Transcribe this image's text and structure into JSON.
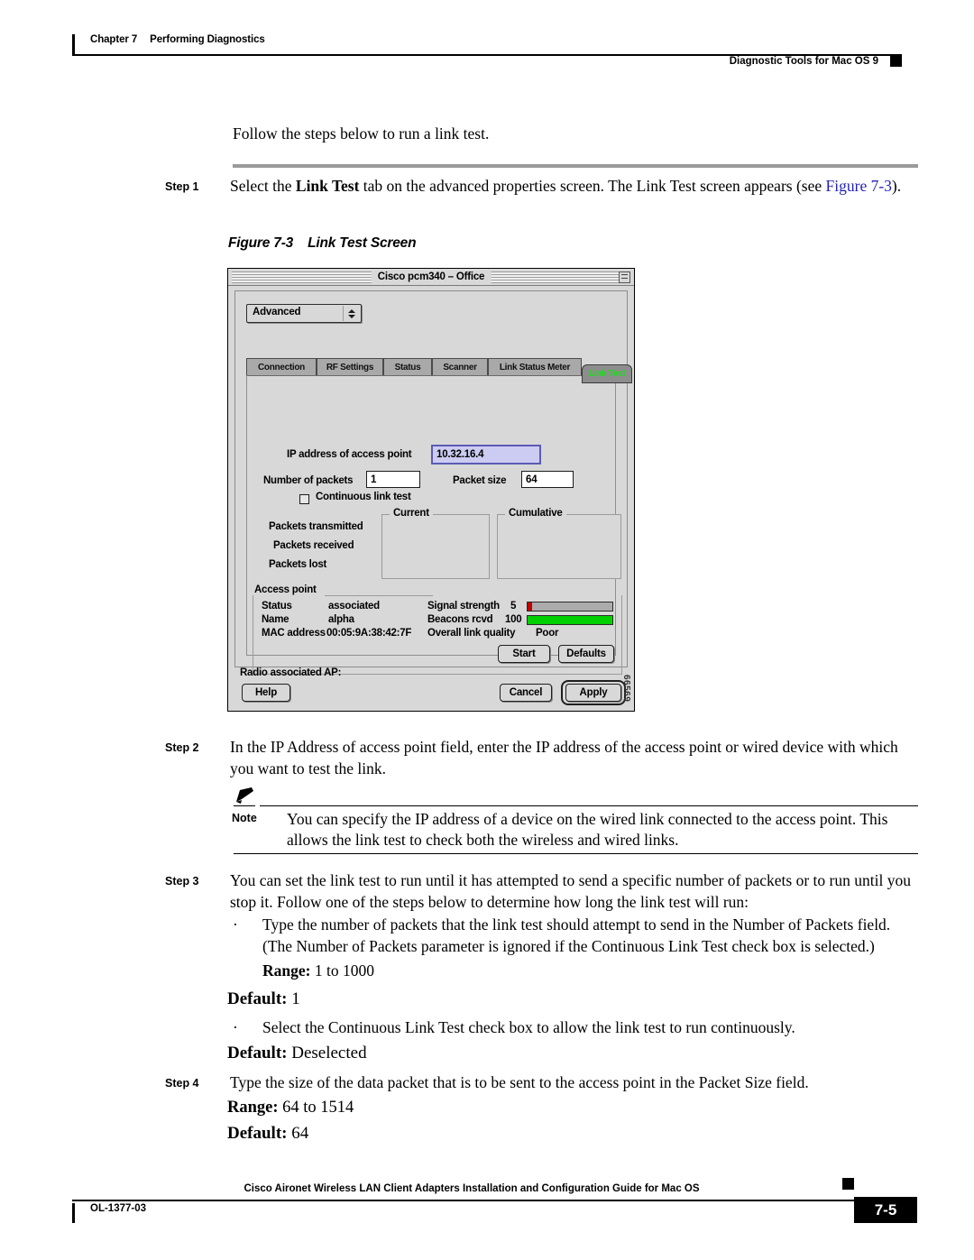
{
  "running_head": {
    "chapter": "Chapter 7",
    "chapter_title": "Performing Diagnostics",
    "section": "Diagnostic Tools for Mac OS 9"
  },
  "intro": "Follow the steps below to run a link test.",
  "steps": [
    {
      "label": "Step 1",
      "text_before": "Select the ",
      "bold": "Link Test",
      "text_after": " tab on the advanced properties screen. The Link Test screen appears (see ",
      "link": "Figure 7-3",
      "text_end": ")."
    },
    {
      "label": "Step 2",
      "text": "In the IP Address of access point field, enter the IP address of the access point or wired device with which you want to test the link."
    },
    {
      "label": "Step 3",
      "text": "You can set the link test to run until it has attempted to send a specific number of packets or to run until you stop it. Follow one of the steps below to determine how long the link test will run:"
    },
    {
      "label": "Step 4",
      "text": "Type the size of the data packet that is to be sent to the access point in the Packet Size field."
    }
  ],
  "figure": {
    "caption_number": "Figure 7-3",
    "caption_title": "Link Test Screen",
    "figure_id": "66569"
  },
  "note": {
    "label": "Note",
    "text": "You can specify the IP address of a device on the wired link connected to the access point. This allows the link test to check both the wireless and wired links."
  },
  "bullets": [
    {
      "marker": "·",
      "text": "Type the number of packets that the link test should attempt to send in the Number of Packets field. (The Number of Packets parameter is ignored if the Continuous Link Test check box is selected.)",
      "range_label": "Range:",
      "range_value": " 1 to 1000",
      "default_label": "Default:",
      "default_value": " 1"
    },
    {
      "marker": "·",
      "text": "Select the Continuous Link Test check box to allow the link test to run continuously.",
      "default_label": "Default:",
      "default_value": " Deselected"
    }
  ],
  "step4_specs": {
    "range_label": "Range:",
    "range_value": " 64 to 1514",
    "default_label": "Default:",
    "default_value": " 64"
  },
  "dialog": {
    "title": "Cisco pcm340 – Office",
    "popup_selected": "Advanced",
    "tabs": [
      {
        "label": "Connection",
        "active": false
      },
      {
        "label": "RF Settings",
        "active": false
      },
      {
        "label": "Status",
        "active": false
      },
      {
        "label": "Scanner",
        "active": false
      },
      {
        "label": "Link Status Meter",
        "active": false
      },
      {
        "label": "Link Test",
        "active": true
      }
    ],
    "fields": {
      "ip_label": "IP address of access point",
      "ip_value": "10.32.16.4",
      "packets_label": "Number of packets",
      "packets_value": "1",
      "packet_size_label": "Packet size",
      "packet_size_value": "64",
      "continuous_label": "Continuous link test",
      "continuous_checked": false
    },
    "stats": {
      "rows": [
        "Packets transmitted",
        "Packets received",
        "Packets lost"
      ],
      "col_current": "Current",
      "col_cumulative": "Cumulative",
      "current_values": [
        "",
        "",
        ""
      ],
      "cumulative_values": [
        "",
        "",
        ""
      ]
    },
    "access_point": {
      "group_label": "Access point",
      "status_label": "Status",
      "status_value": "associated",
      "name_label": "Name",
      "name_value": "alpha",
      "mac_label": "MAC address",
      "mac_value": "00:05:9A:38:42:7F",
      "signal_label": "Signal strength",
      "signal_value": "5",
      "signal_percent": 5,
      "beacons_label": "Beacons rcvd",
      "beacons_value": "100",
      "beacons_percent": 100,
      "quality_label": "Overall link quality",
      "quality_value": "Poor"
    },
    "buttons": {
      "start": "Start",
      "defaults": "Defaults",
      "help": "Help",
      "cancel": "Cancel",
      "apply": "Apply"
    },
    "radio_associated": "Radio associated  AP:",
    "colors": {
      "window_bg": "#d8d8d8",
      "active_tab_text": "#17e017",
      "signal_bar": "#c40000",
      "beacon_bar": "#00cf00",
      "focus_field_bg": "#ccccf2"
    }
  },
  "footer": {
    "title": "Cisco Aironet Wireless LAN Client Adapters Installation and Configuration Guide for Mac OS",
    "doc_number": "OL-1377-03",
    "page_number": "7-5"
  }
}
